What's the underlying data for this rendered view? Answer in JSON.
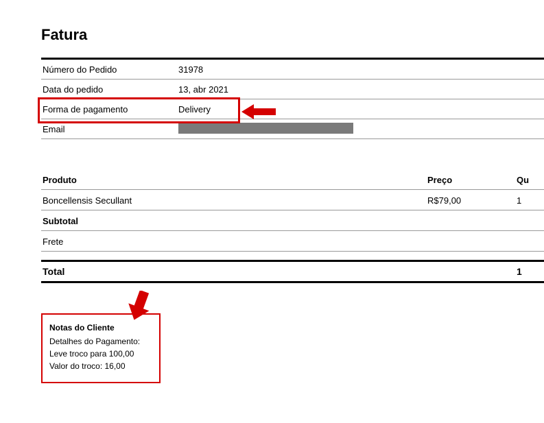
{
  "title": "Fatura",
  "info": {
    "order_number_label": "Número do Pedido",
    "order_number_value": "31978",
    "order_date_label": "Data do pedido",
    "order_date_value": "13, abr 2021",
    "payment_method_label": "Forma de pagamento",
    "payment_method_value": "Delivery",
    "email_label": "Email"
  },
  "products": {
    "header_product": "Produto",
    "header_price": "Preço",
    "header_qty": "Qu",
    "row": {
      "name": "Boncellensis Secullant",
      "price": "R$79,00",
      "qty": "1"
    },
    "subtotal_label": "Subtotal",
    "frete_label": "Frete"
  },
  "total": {
    "label": "Total",
    "qty": "1"
  },
  "notes": {
    "title": "Notas do Cliente",
    "line1": "Detalhes do Pagamento:",
    "line2": "Leve troco para 100,00",
    "line3": "Valor do troco: 16,00"
  }
}
